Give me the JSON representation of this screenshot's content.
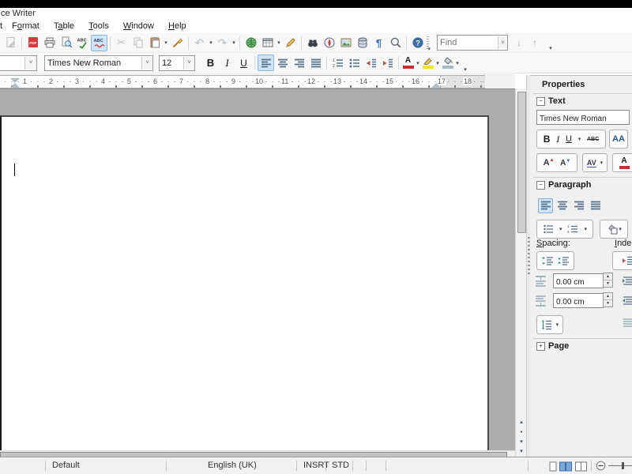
{
  "window": {
    "title": "ce Writer"
  },
  "menubar": {
    "fragment": "t",
    "items": [
      {
        "label": "Format",
        "u": 1
      },
      {
        "label": "Table",
        "u": 1
      },
      {
        "label": "Tools",
        "u": 0
      },
      {
        "label": "Window",
        "u": 0
      },
      {
        "label": "Help",
        "u": 0
      }
    ]
  },
  "toolbars": {
    "standard_icons": [
      "edit-file",
      "export-pdf",
      "print",
      "print-preview",
      "spelling",
      "auto-spellcheck",
      "cut",
      "copy",
      "paste",
      "clone-formatting",
      "undo",
      "redo",
      "hyperlink",
      "insert-table",
      "draw-functions",
      "find-replace",
      "navigator",
      "gallery",
      "data-sources",
      "formatting-marks",
      "zoom",
      "help"
    ],
    "find": {
      "placeholder": "Find"
    },
    "formatting": {
      "font_name": "Times New Roman",
      "font_size": "12",
      "icons": [
        "style-combo",
        "font-name",
        "font-size",
        "bold",
        "italic",
        "underline",
        "align-left",
        "align-center",
        "align-right",
        "align-justify",
        "numbered-list",
        "bulleted-list",
        "increase-indent",
        "decrease-indent",
        "font-color",
        "highlight-color",
        "background-color"
      ]
    }
  },
  "glyphs": {
    "bold": "B",
    "italic": "I",
    "underline": "U",
    "strike": "ABC",
    "spell": "ABC",
    "autospell": "ABC",
    "pdf": "PDF",
    "help": "?",
    "pilcrow": "¶",
    "shadow": "AA",
    "grow_font": "A",
    "shrink_font": "A",
    "kerning": "AV",
    "font_color": "A",
    "cut": "✂"
  },
  "ruler": {
    "numbers": [
      1,
      2,
      3,
      4,
      5,
      6,
      7,
      8,
      9,
      10,
      11,
      12,
      13,
      14,
      15,
      16,
      17,
      18
    ]
  },
  "sidebar": {
    "title": "Properties",
    "text_section": {
      "label": "Text",
      "font_name": "Times New Roman"
    },
    "paragraph_section": {
      "label": "Paragraph",
      "spacing": {
        "label": "Spacing:",
        "u": 0
      },
      "indent": {
        "label": "Indent:",
        "u": 0
      },
      "above_spacing": "0.00 cm",
      "below_spacing": "0.00 cm"
    },
    "page_section": {
      "label": "Page"
    }
  },
  "statusbar": {
    "page_style": "Default",
    "language": "English (UK)",
    "insert_mode": "INSRT",
    "selection_mode": "STD"
  }
}
